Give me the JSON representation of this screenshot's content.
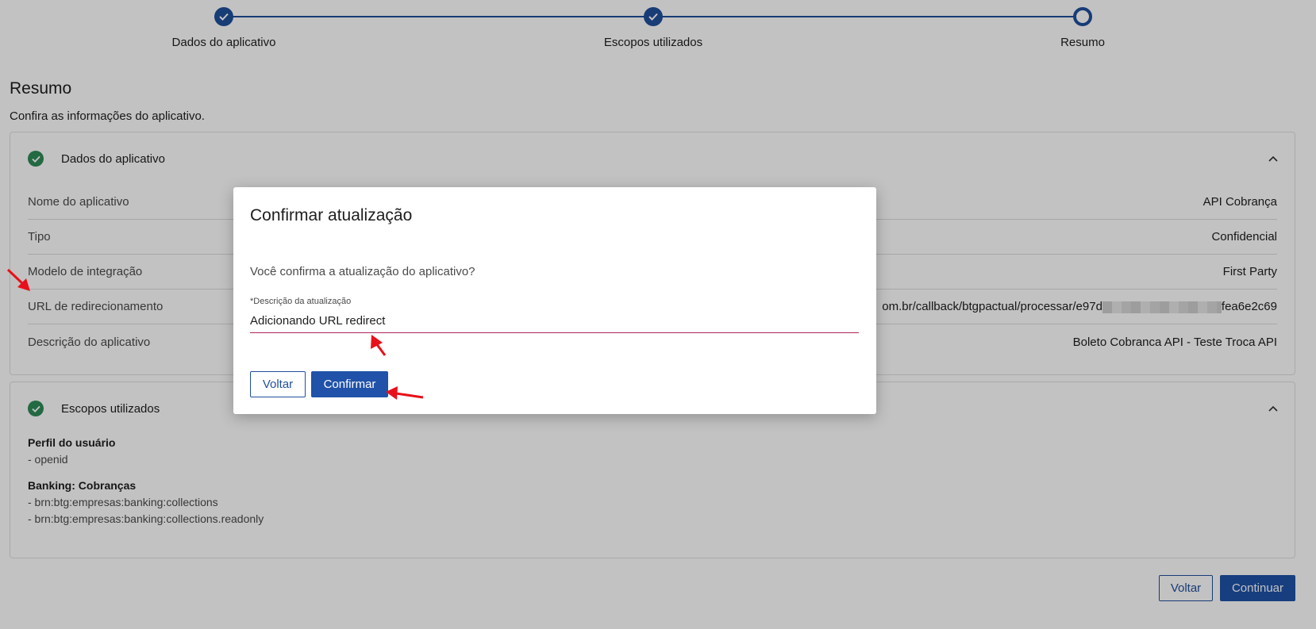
{
  "stepper": {
    "steps": [
      {
        "label": "Dados do aplicativo",
        "state": "done"
      },
      {
        "label": "Escopos utilizados",
        "state": "done"
      },
      {
        "label": "Resumo",
        "state": "current"
      }
    ]
  },
  "page": {
    "title": "Resumo",
    "subtitle": "Confira as informações do aplicativo."
  },
  "app_card": {
    "title": "Dados do aplicativo",
    "rows": [
      {
        "label": "Nome do aplicativo",
        "value": "API Cobrança"
      },
      {
        "label": "Tipo",
        "value": "Confidencial"
      },
      {
        "label": "Modelo de integração",
        "value": "First Party"
      },
      {
        "label": "URL de redirecionamento",
        "value_prefix": "om.br/callback/btgpactual/processar/e97d",
        "value_suffix": "fea6e2c69"
      },
      {
        "label": "Descrição do aplicativo",
        "value": "Boleto Cobranca API - Teste Troca API"
      }
    ]
  },
  "scopes_card": {
    "title": "Escopos utilizados",
    "groups": [
      {
        "title": "Perfil do usuário",
        "items": [
          "- openid"
        ]
      },
      {
        "title": "Banking: Cobranças",
        "items": [
          "- brn:btg:empresas:banking:collections",
          "- brn:btg:empresas:banking:collections.readonly"
        ]
      }
    ]
  },
  "footer": {
    "back_label": "Voltar",
    "continue_label": "Continuar"
  },
  "modal": {
    "title": "Confirmar atualização",
    "question": "Você confirma a atualização do aplicativo?",
    "field_label": "*Descrição da atualização",
    "field_value": "Adicionando URL redirect",
    "back_label": "Voltar",
    "confirm_label": "Confirmar"
  },
  "colors": {
    "primary": "#1f52a8",
    "success": "#2e8b57",
    "field_underline": "#b0245a",
    "annotation": "#e8101a"
  }
}
